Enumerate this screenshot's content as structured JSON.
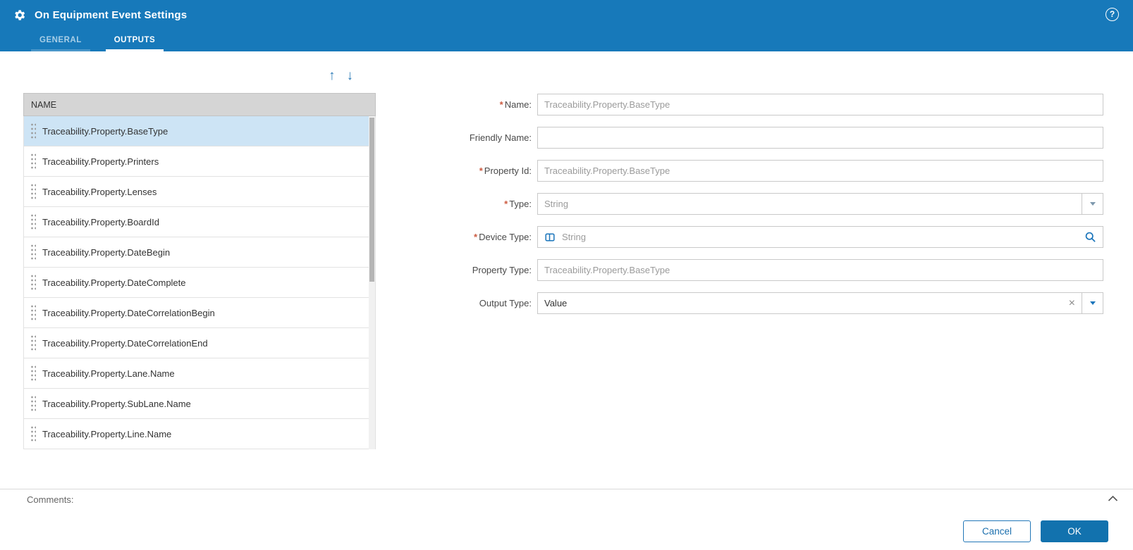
{
  "header": {
    "title": "On Equipment Event Settings",
    "tabs": {
      "general": "GENERAL",
      "outputs": "OUTPUTS"
    }
  },
  "icons": {
    "help": "?",
    "up_arrow": "↑",
    "down_arrow": "↓",
    "clear": "×"
  },
  "list": {
    "header": "NAME",
    "items": [
      "Traceability.Property.BaseType",
      "Traceability.Property.Printers",
      "Traceability.Property.Lenses",
      "Traceability.Property.BoardId",
      "Traceability.Property.DateBegin",
      "Traceability.Property.DateComplete",
      "Traceability.Property.DateCorrelationBegin",
      "Traceability.Property.DateCorrelationEnd",
      "Traceability.Property.Lane.Name",
      "Traceability.Property.SubLane.Name",
      "Traceability.Property.Line.Name"
    ],
    "selected": "Traceability.Property.BaseType"
  },
  "form": {
    "required_marker": "*",
    "name": {
      "label": "Name:",
      "value": "Traceability.Property.BaseType"
    },
    "friendly_name": {
      "label": "Friendly Name:",
      "value": ""
    },
    "property_id": {
      "label": "Property Id:",
      "value": "Traceability.Property.BaseType"
    },
    "type": {
      "label": "Type:",
      "value": "String"
    },
    "device_type": {
      "label": "Device Type:",
      "value": "String"
    },
    "property_type": {
      "label": "Property Type:",
      "value": "Traceability.Property.BaseType"
    },
    "output_type": {
      "label": "Output Type:",
      "value": "Value"
    }
  },
  "footer": {
    "comments_label": "Comments:",
    "cancel_label": "Cancel",
    "ok_label": "OK"
  },
  "colors": {
    "header_blue": "#1779ba",
    "accent_blue": "#1b75bb",
    "selected_row": "#cde4f5",
    "ok_button": "#1272ae"
  }
}
